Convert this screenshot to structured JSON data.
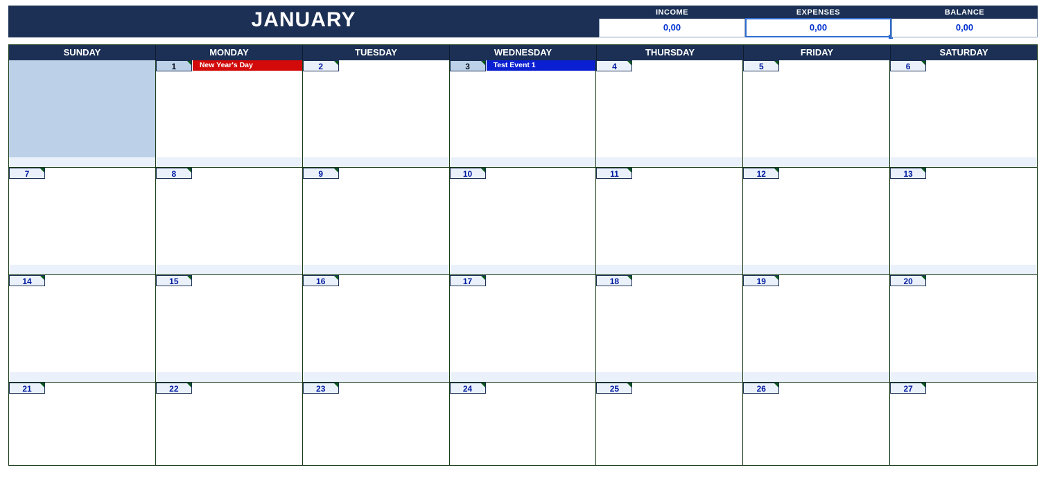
{
  "header": {
    "month_label": "JANUARY"
  },
  "summary": {
    "income": {
      "label": "INCOME",
      "value": "0,00"
    },
    "expenses": {
      "label": "EXPENSES",
      "value": "0,00",
      "selected": true
    },
    "balance": {
      "label": "BALANCE",
      "value": "0,00"
    }
  },
  "calendar": {
    "weekdays": [
      "SUNDAY",
      "MONDAY",
      "TUESDAY",
      "WEDNESDAY",
      "THURSDAY",
      "FRIDAY",
      "SATURDAY"
    ],
    "weeks": [
      [
        {
          "blank_prev": true
        },
        {
          "date": "1",
          "dark_pill": true,
          "event": {
            "label": "New Year's Day",
            "color": "red"
          }
        },
        {
          "date": "2"
        },
        {
          "date": "3",
          "dark_pill": true,
          "event": {
            "label": "Test Event 1",
            "color": "blue"
          }
        },
        {
          "date": "4"
        },
        {
          "date": "5"
        },
        {
          "date": "6"
        }
      ],
      [
        {
          "date": "7"
        },
        {
          "date": "8"
        },
        {
          "date": "9"
        },
        {
          "date": "10"
        },
        {
          "date": "11"
        },
        {
          "date": "12"
        },
        {
          "date": "13"
        }
      ],
      [
        {
          "date": "14"
        },
        {
          "date": "15"
        },
        {
          "date": "16"
        },
        {
          "date": "17"
        },
        {
          "date": "18"
        },
        {
          "date": "19"
        },
        {
          "date": "20"
        }
      ],
      [
        {
          "date": "21"
        },
        {
          "date": "22"
        },
        {
          "date": "23"
        },
        {
          "date": "24"
        },
        {
          "date": "25"
        },
        {
          "date": "26"
        },
        {
          "date": "27"
        }
      ]
    ]
  }
}
